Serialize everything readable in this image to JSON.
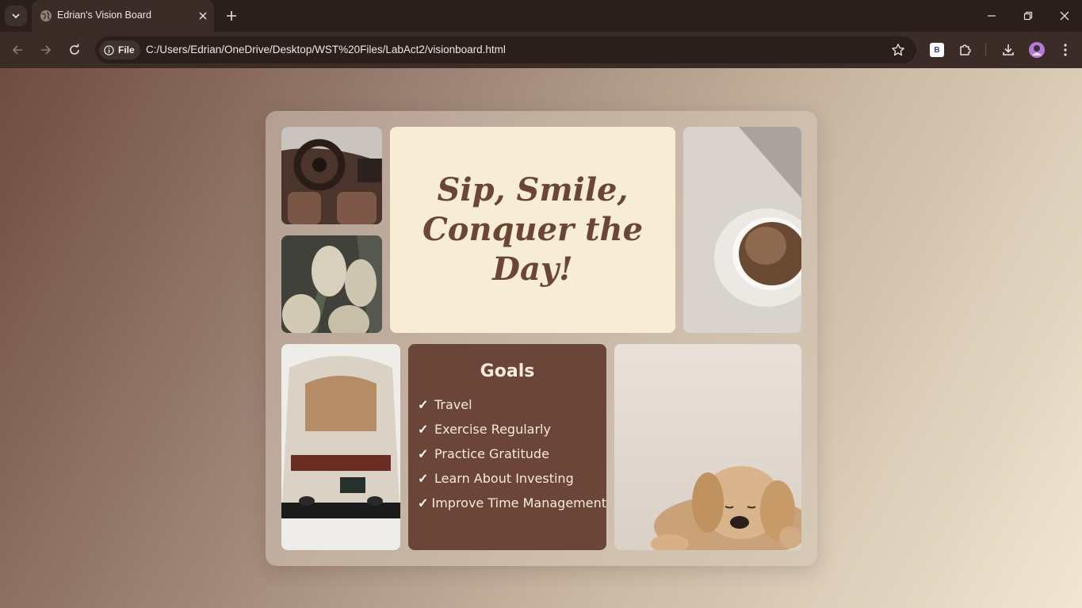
{
  "browser": {
    "tab": {
      "title": "Edrian's Vision Board"
    },
    "address_bar": {
      "chip_label": "File",
      "url": "C:/Users/Edrian/OneDrive/Desktop/WST%20Files/LabAct2/visionboard.html"
    },
    "toolbar_badge": "B"
  },
  "page": {
    "quote": "Sip, Smile, Conquer the Day!",
    "goals": {
      "title": "Goals",
      "check_symbol": "✓",
      "items": [
        "Travel",
        "Exercise Regularly",
        "Practice Gratitude",
        "Learn About Investing",
        "Improve Time Management"
      ]
    }
  },
  "colors": {
    "chrome_dark": "#2b1f1b",
    "chrome_toolbar": "#3b2c27",
    "quote_card": "#f7ecd4",
    "quote_text": "#6b4537",
    "goals_card": "#6a4538",
    "goals_text": "#f6ebd9"
  }
}
